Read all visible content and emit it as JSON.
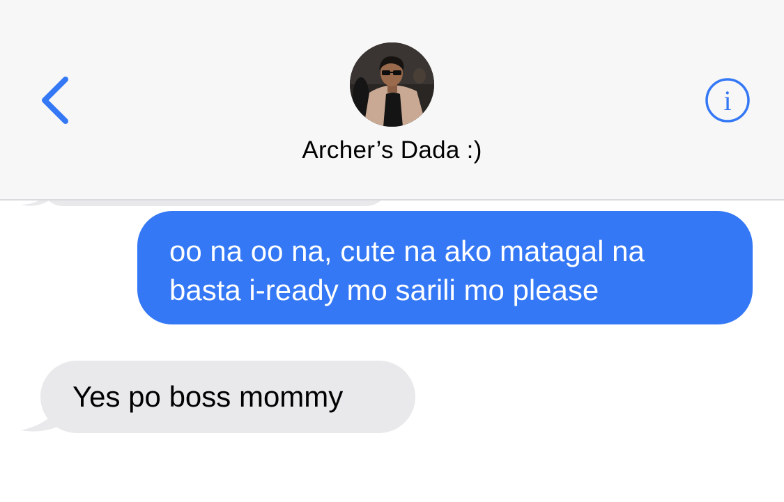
{
  "header": {
    "contact_name": "Archer’s Dada :)",
    "back_icon": "chevron-left-icon",
    "info_icon": "info-circle-icon",
    "avatar": "contact-avatar-photo"
  },
  "messages": [
    {
      "direction": "outgoing",
      "lines": [
        "oo na oo na, cute na ako matagal na",
        "basta i-ready mo sarili mo please"
      ]
    },
    {
      "direction": "incoming",
      "text": "Yes po boss mommy"
    }
  ],
  "colors": {
    "accent": "#3478f6",
    "incoming_bubble": "#e9e9eb",
    "header_bg": "#f7f7f7"
  }
}
